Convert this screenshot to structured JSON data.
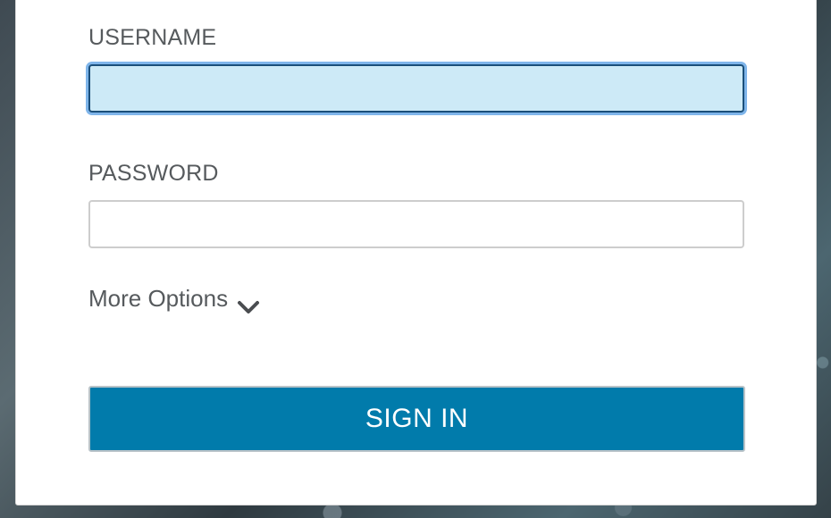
{
  "form": {
    "username_label": "USERNAME",
    "username_value": "",
    "password_label": "PASSWORD",
    "password_value": "",
    "more_options_label": "More Options",
    "more_options_icon": "chevron-down-icon",
    "signin_label": "SIGN IN"
  },
  "colors": {
    "primary_button": "#017bab",
    "focused_field_bg": "#cdeaf7",
    "focus_ring": "#7fb5ea",
    "label_text": "#565a5d"
  }
}
